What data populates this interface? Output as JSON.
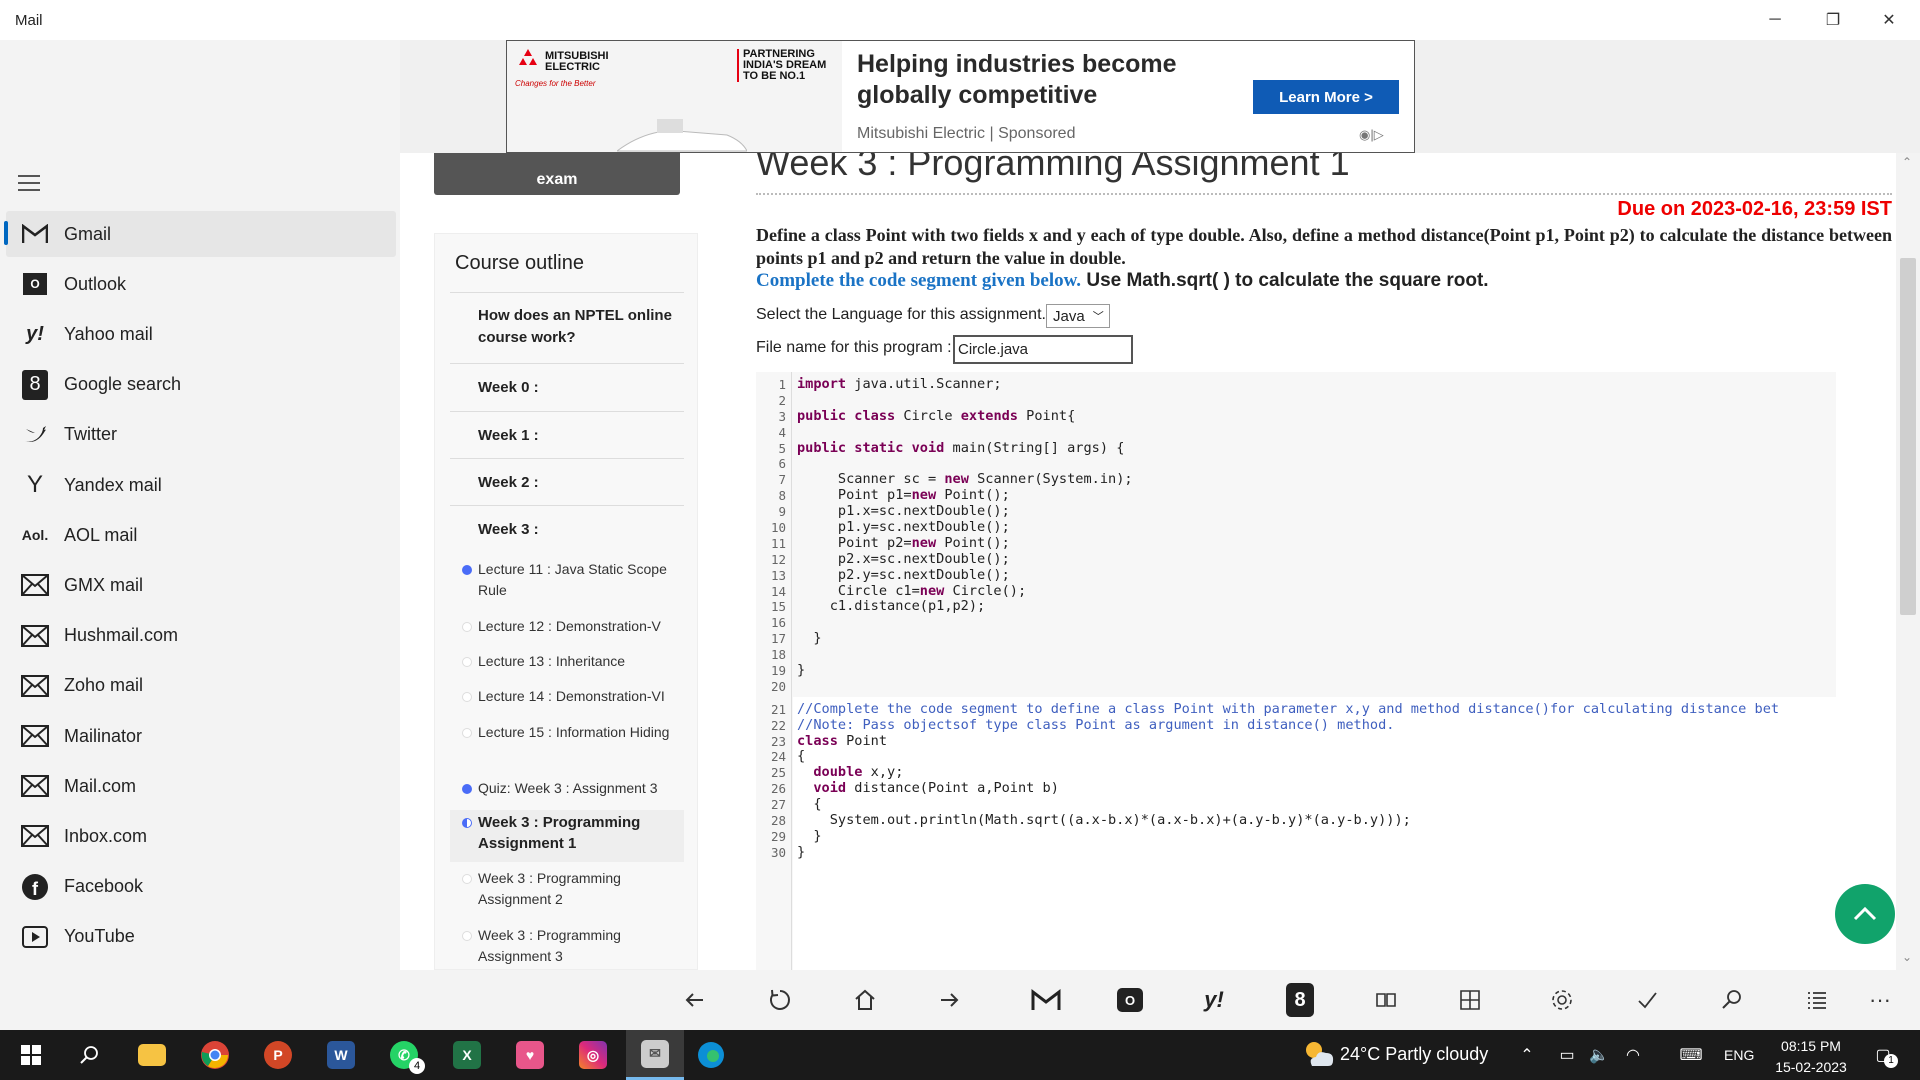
{
  "window": {
    "title": "Mail",
    "minimize": "─",
    "maximize": "❐",
    "close": "✕"
  },
  "sidebar": {
    "items": [
      {
        "label": "Gmail",
        "icon": "gmail-icon"
      },
      {
        "label": "Outlook",
        "icon": "outlook-icon"
      },
      {
        "label": "Yahoo mail",
        "icon": "yahoo-icon"
      },
      {
        "label": "Google search",
        "icon": "google-search-icon"
      },
      {
        "label": "Twitter",
        "icon": "twitter-icon"
      },
      {
        "label": "Yandex mail",
        "icon": "yandex-icon"
      },
      {
        "label": "AOL mail",
        "icon": "aol-icon"
      },
      {
        "label": "GMX mail",
        "icon": "mail-envelope-icon"
      },
      {
        "label": "Hushmail.com",
        "icon": "mail-envelope-icon"
      },
      {
        "label": "Zoho mail",
        "icon": "mail-envelope-icon"
      },
      {
        "label": "Mailinator",
        "icon": "mail-envelope-icon"
      },
      {
        "label": "Mail.com",
        "icon": "mail-envelope-icon"
      },
      {
        "label": "Inbox.com",
        "icon": "mail-envelope-icon"
      },
      {
        "label": "Facebook",
        "icon": "facebook-icon"
      },
      {
        "label": "YouTube",
        "icon": "youtube-icon"
      }
    ],
    "active_index": 0
  },
  "ad": {
    "brand_line1": "MITSUBISHI",
    "brand_line2": "ELECTRIC",
    "brand_tagline": "Changes for the Better",
    "partner_text": "PARTNERING INDIA'S DREAM TO BE NO.1",
    "headline": "Helping industries become globally competitive",
    "cta": "Learn More >",
    "sponsor": "Mitsubishi Electric | Sponsored"
  },
  "register_button": "exam",
  "outline": {
    "title": "Course outline",
    "headings": [
      "How does an NPTEL online course work?",
      "Week 0 :",
      "Week 1 :",
      "Week 2 :",
      "Week 3 :"
    ],
    "items": [
      {
        "label": "Lecture 11 : Java Static Scope Rule",
        "status": "done"
      },
      {
        "label": "Lecture 12 : Demonstration-V",
        "status": "todo"
      },
      {
        "label": "Lecture 13 : Inheritance",
        "status": "todo"
      },
      {
        "label": "Lecture 14 : Demonstration-VI",
        "status": "todo"
      },
      {
        "label": "Lecture 15 : Information Hiding",
        "status": "todo"
      },
      {
        "label": "Quiz: Week 3 : Assignment 3",
        "status": "done"
      },
      {
        "label": "Week 3 : Programming Assignment 1",
        "status": "current"
      },
      {
        "label": "Week 3 : Programming Assignment 2",
        "status": "todo"
      },
      {
        "label": "Week 3 : Programming Assignment 3",
        "status": "todo"
      }
    ]
  },
  "assignment": {
    "title": "Week 3 : Programming Assignment 1",
    "due": "Due on 2023-02-16, 23:59 IST",
    "question": "Define a class Point with two fields x and y each of type double. Also, define a method distance(Point p1, Point p2) to calculate the distance between points p1 and p2 and return the value in double.",
    "instruction_blue": "Complete the code segment given below.",
    "instruction_black": " Use Math.sqrt( ) to calculate the square root.",
    "language_label": "Select the Language for this assignment.",
    "language_value": "Java",
    "file_label": "File name for this program :",
    "file_value": "Circle.java"
  },
  "code": [
    "import java.util.Scanner;",
    "",
    "public class Circle extends Point{",
    "",
    "public static void main(String[] args) {",
    "",
    "     Scanner sc = new Scanner(System.in);",
    "     Point p1=new Point();",
    "     p1.x=sc.nextDouble();",
    "     p1.y=sc.nextDouble();",
    "     Point p2=new Point();",
    "     p2.x=sc.nextDouble();",
    "     p2.y=sc.nextDouble();",
    "     Circle c1=new Circle();",
    "    c1.distance(p1,p2);",
    "",
    "  }",
    "",
    "}",
    "",
    "//Complete the code segment to define a class Point with parameter x,y and method distance()for calculating distance bet",
    "//Note: Pass objectsof type class Point as argument in distance() method.",
    "class Point",
    "{",
    "  double x,y;",
    "  void distance(Point a,Point b)",
    "  {",
    "    System.out.println(Math.sqrt((a.x-b.x)*(a.x-b.x)+(a.y-b.y)*(a.y-b.y)));",
    "  }",
    "}"
  ],
  "taskbar": {
    "weather": "24°C  Partly cloudy",
    "language": "ENG",
    "time": "08:15 PM",
    "date": "15-02-2023",
    "whatsapp_badge": "4",
    "notification_badge": "1"
  },
  "colors": {
    "accent": "#0067c0",
    "due_red": "#e00000",
    "cta_blue": "#0f5bb5",
    "fab_green": "#11a36b"
  }
}
